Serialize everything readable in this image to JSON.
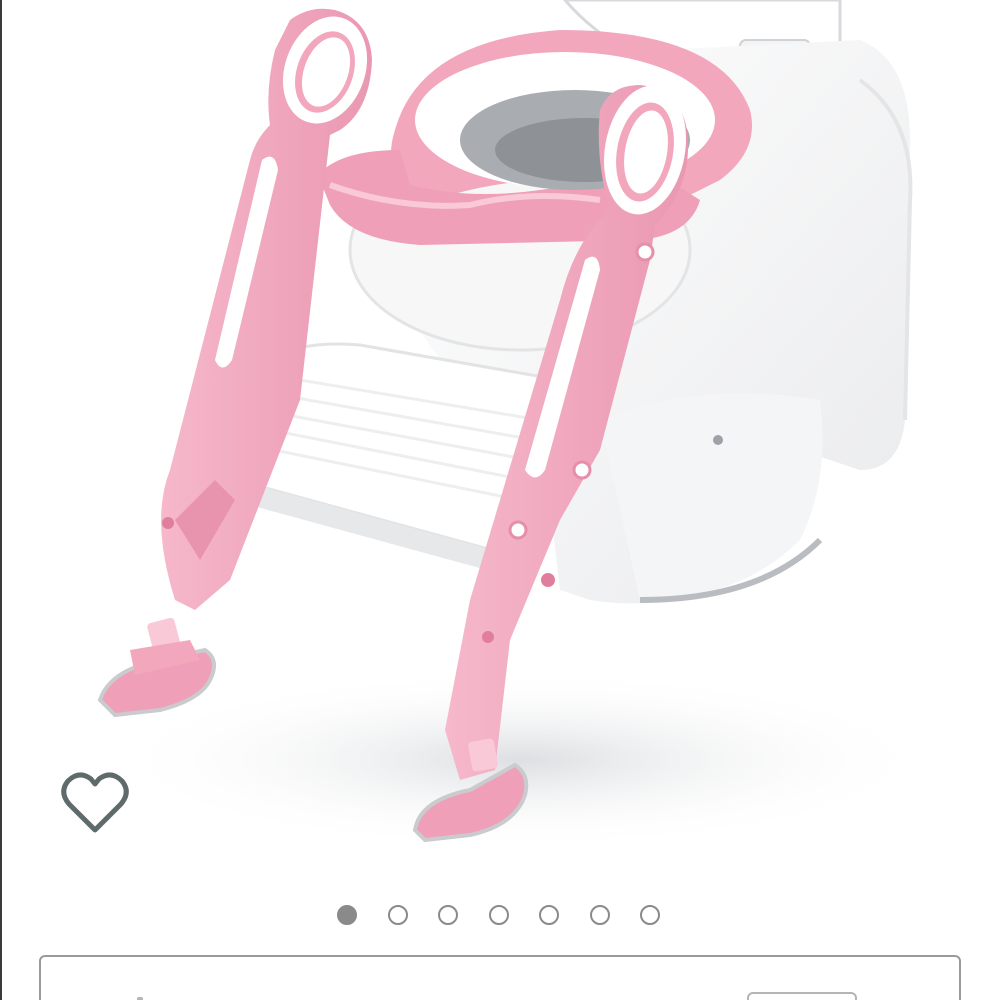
{
  "product": {
    "image_icon": "toddler-potty-ladder-image",
    "image_colors": {
      "pink": "#f2a7bd",
      "pink_dark": "#e58fab",
      "white": "#ffffff",
      "grey_inner": "#9b9ea3"
    }
  },
  "wishlist": {
    "icon": "heart-outline-icon",
    "color": "#5f6b6b"
  },
  "carousel": {
    "total": 7,
    "active_index": 0,
    "dot_color": "#8a8a8a"
  }
}
